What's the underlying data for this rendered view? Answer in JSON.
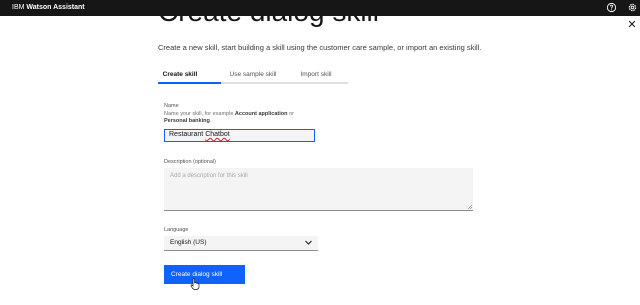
{
  "app": {
    "brand": "IBM",
    "product": "Watson Assistant"
  },
  "page": {
    "title": "Create dialog skill",
    "subtitle": "Create a new skill, start building a skill using the customer care sample, or import an existing skill."
  },
  "tabs": [
    {
      "label": "Create skill",
      "active": true
    },
    {
      "label": "Use sample skill",
      "active": false
    },
    {
      "label": "Import skill",
      "active": false
    }
  ],
  "form": {
    "name": {
      "label": "Name",
      "helper_prefix": "Name your skill, for example ",
      "helper_example1": "Account application",
      "helper_or": " or ",
      "helper_example2": "Personal banking",
      "helper_suffix": ".",
      "value_word1": "Restaurant",
      "value_word2": "Chatbot"
    },
    "description": {
      "label": "Description (optional)",
      "placeholder": "Add a description for this skill"
    },
    "language": {
      "label": "Language",
      "selected": "English (US)"
    },
    "submit_label": "Create dialog skill"
  },
  "icons": {
    "help": "help-icon",
    "settings": "settings-icon",
    "close": "close-icon",
    "chevron": "chevron-down-icon",
    "cursor": "hand-pointer-icon"
  },
  "colors": {
    "topbar": "#161616",
    "primary": "#0f62fe",
    "field_bg": "#f4f4f4",
    "tab_line": "#e0e0e0"
  }
}
